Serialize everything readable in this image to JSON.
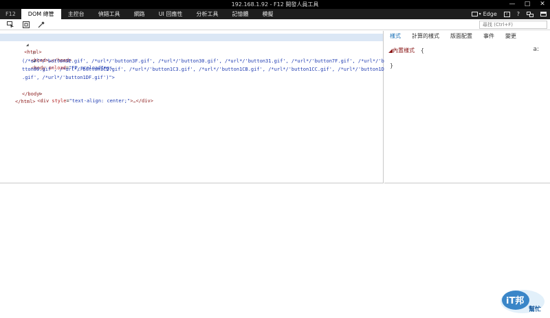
{
  "window": {
    "title": "192.168.1.92 - F12 開發人員工具",
    "controls": [
      "—",
      "□",
      "✕"
    ]
  },
  "tabs": {
    "f12": "F12",
    "items": [
      {
        "label": "DOM 總管",
        "active": true
      },
      {
        "label": "主控台",
        "active": false
      },
      {
        "label": "偵錯工具",
        "active": false
      },
      {
        "label": "網路",
        "active": false
      },
      {
        "label": "UI 回應性",
        "active": false
      },
      {
        "label": "分析工具",
        "active": false
      },
      {
        "label": "記憶體",
        "active": false
      },
      {
        "label": "模擬",
        "active": false
      }
    ],
    "emulation_mode": "Edge",
    "help_glyph": "?"
  },
  "toolbar": {
    "find_placeholder": "尋找 (Ctrl+F)"
  },
  "dom": {
    "lines": [
      {
        "expander": "◢",
        "markup": "<html>"
      },
      {
        "expander": "▷",
        "markup": "<head>…</head>"
      },
      {
        "expander": "◢",
        "markup_open": "<body ",
        "attr": "onload",
        "eq": "=",
        "value": "\"FP_preloadImgs"
      },
      {
        "text": "(/*url*/'button3E.gif', /*url*/'button3F.gif', /*url*/'button30.gif', /*url*/'button31.gif', /*url*/'button7F.gif', /*url*/'bu"
      },
      {
        "text": "tton80.gif', /*url*/'button1C2.gif', /*url*/'button1C3.gif', /*url*/'button1CB.gif', /*url*/'button1CC.gif', /*url*/'button1DE"
      },
      {
        "text": ".gif', /*url*/'button1DF.gif')\">"
      },
      {
        "expander": "▷",
        "markup_open": "<div ",
        "attr": "style",
        "eq": "=",
        "value": "\"text-align: center;\"",
        "close": ">…</div>"
      },
      {
        "markup": "</body>"
      },
      {
        "markup": "</html>"
      }
    ]
  },
  "styles_pane": {
    "tabs": [
      {
        "label": "樣式",
        "active": true
      },
      {
        "label": "計算的樣式",
        "active": false
      },
      {
        "label": "版面配置",
        "active": false
      },
      {
        "label": "事件",
        "active": false
      },
      {
        "label": "變更",
        "active": false
      }
    ],
    "inline_label": "◢內置樣式",
    "open_brace": "{",
    "close_brace": "}",
    "new_rule_glyph": "a:"
  },
  "watermark": {
    "logo_text": "iT邦",
    "logo_sub": "幫忙"
  },
  "colors": {
    "tag": "#8b1a1a",
    "attr": "#b22222",
    "value": "#1c39b0",
    "accent": "#1e73b8",
    "selection": "#dbe7f5"
  }
}
